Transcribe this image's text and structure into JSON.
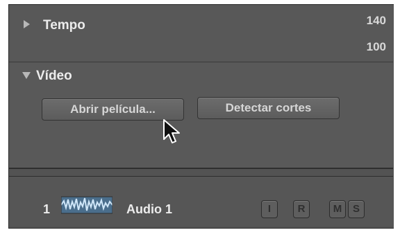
{
  "tempo": {
    "title": "Tempo",
    "value_high": "140",
    "value_low": "100"
  },
  "video": {
    "title": "Vídeo",
    "open_movie_label": "Abrir película...",
    "detect_cuts_label": "Detectar cortes"
  },
  "track": {
    "number": "1",
    "name": "Audio 1",
    "buttons": {
      "input": "I",
      "record": "R",
      "mute": "M",
      "solo": "S"
    }
  },
  "icons": {
    "tempo_disclosure": "disclosure-triangle-right-icon",
    "video_disclosure": "disclosure-triangle-down-icon",
    "track_waveform": "audio-waveform-icon",
    "pointer": "mouse-pointer-icon"
  },
  "colors": {
    "panel_bg": "#535353",
    "text_light": "#ececec",
    "waveform": "#7fb6e0"
  }
}
